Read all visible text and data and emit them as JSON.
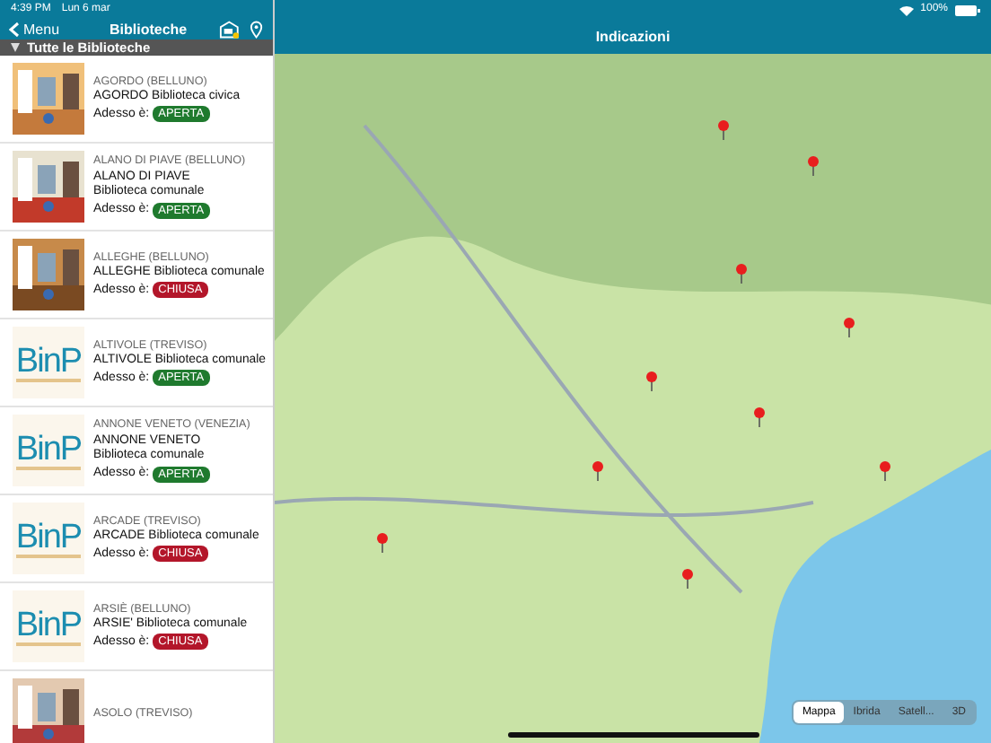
{
  "status_bar": {
    "time": "4:39 PM",
    "date": "Lun 6 mar",
    "battery": "100%"
  },
  "sidebar": {
    "back": "Menu",
    "title": "Biblioteche",
    "filter": "Tutte le Biblioteche",
    "items": [
      {
        "place": "AGORDO (BELLUNO)",
        "name": "AGORDO Biblioteca civica",
        "status_label": "Adesso è:",
        "status": "APERTA",
        "open": true
      },
      {
        "place": "ALANO DI PIAVE (BELLUNO)",
        "name": "ALANO DI PIAVE\nBiblioteca comunale",
        "status_label": "Adesso è:",
        "status": "APERTA",
        "open": true
      },
      {
        "place": "ALLEGHE (BELLUNO)",
        "name": "ALLEGHE Biblioteca comunale",
        "status_label": "Adesso è:",
        "status": "CHIUSA",
        "open": false
      },
      {
        "thumbnail": {
          "kind": "logo",
          "text": "BinP"
        },
        "place": "ALTIVOLE (TREVISO)",
        "name": "ALTIVOLE Biblioteca comunale",
        "status_label": "Adesso è:",
        "status": "APERTA",
        "open": true
      },
      {
        "thumbnail": {
          "kind": "logo",
          "text": "BinP"
        },
        "place": "ANNONE VENETO (VENEZIA)",
        "name": "ANNONE VENETO\nBiblioteca comunale",
        "status_label": "Adesso è:",
        "status": "APERTA",
        "open": true
      },
      {
        "thumbnail": {
          "kind": "logo",
          "text": "BinP"
        },
        "place": "ARCADE (TREVISO)",
        "name": "ARCADE Biblioteca comunale",
        "status_label": "Adesso è:",
        "status": "CHIUSA",
        "open": false
      },
      {
        "thumbnail": {
          "kind": "logo",
          "text": "BinP"
        },
        "place": "ARSIÈ (BELLUNO)",
        "name": "ARSIE' Biblioteca comunale",
        "status_label": "Adesso è:",
        "status": "CHIUSA",
        "open": false
      },
      {
        "place": "ASOLO (TREVISO)"
      }
    ]
  },
  "map": {
    "title": "Indicazioni",
    "kind": "picture",
    "map_types": [
      {
        "label": "Mappa",
        "selected": true
      },
      {
        "label": "Ibrida",
        "selected": false
      },
      {
        "label": "Satell...",
        "selected": false
      },
      {
        "label": "3D",
        "selected": false
      }
    ]
  }
}
